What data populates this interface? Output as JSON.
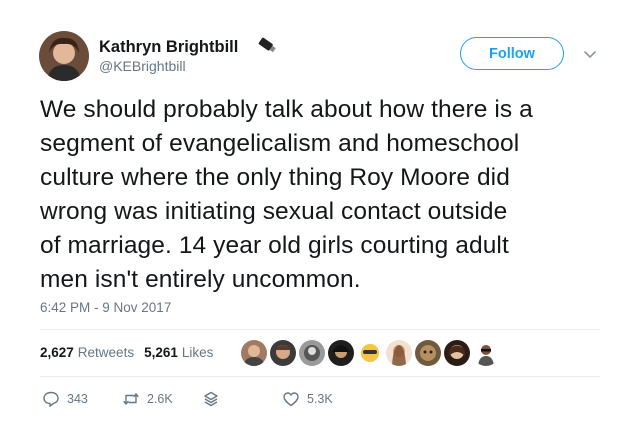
{
  "tweet": {
    "author": {
      "name": "Kathryn Brightbill",
      "handle": "@KEBrightbill"
    },
    "follow_label": "Follow",
    "text_lines": [
      "We should probably talk about how there is a",
      "segment of evangelicalism and homeschool",
      "culture where the only thing Roy Moore did",
      "wrong was initiating sexual contact outside",
      "of marriage. 14 year old girls courting adult",
      "men isn't entirely uncommon."
    ],
    "timestamp": "6:42 PM - 9 Nov 2017",
    "stats": {
      "retweets_count": "2,627",
      "retweets_label": "Retweets",
      "likes_count": "5,261",
      "likes_label": "Likes"
    },
    "actions": {
      "replies": "343",
      "retweets": "2.6K",
      "likes": "5.3K"
    }
  },
  "colors": {
    "accent": "#1da1f2",
    "muted": "#657786",
    "text": "#14171a",
    "divider": "#e6ecf0"
  }
}
